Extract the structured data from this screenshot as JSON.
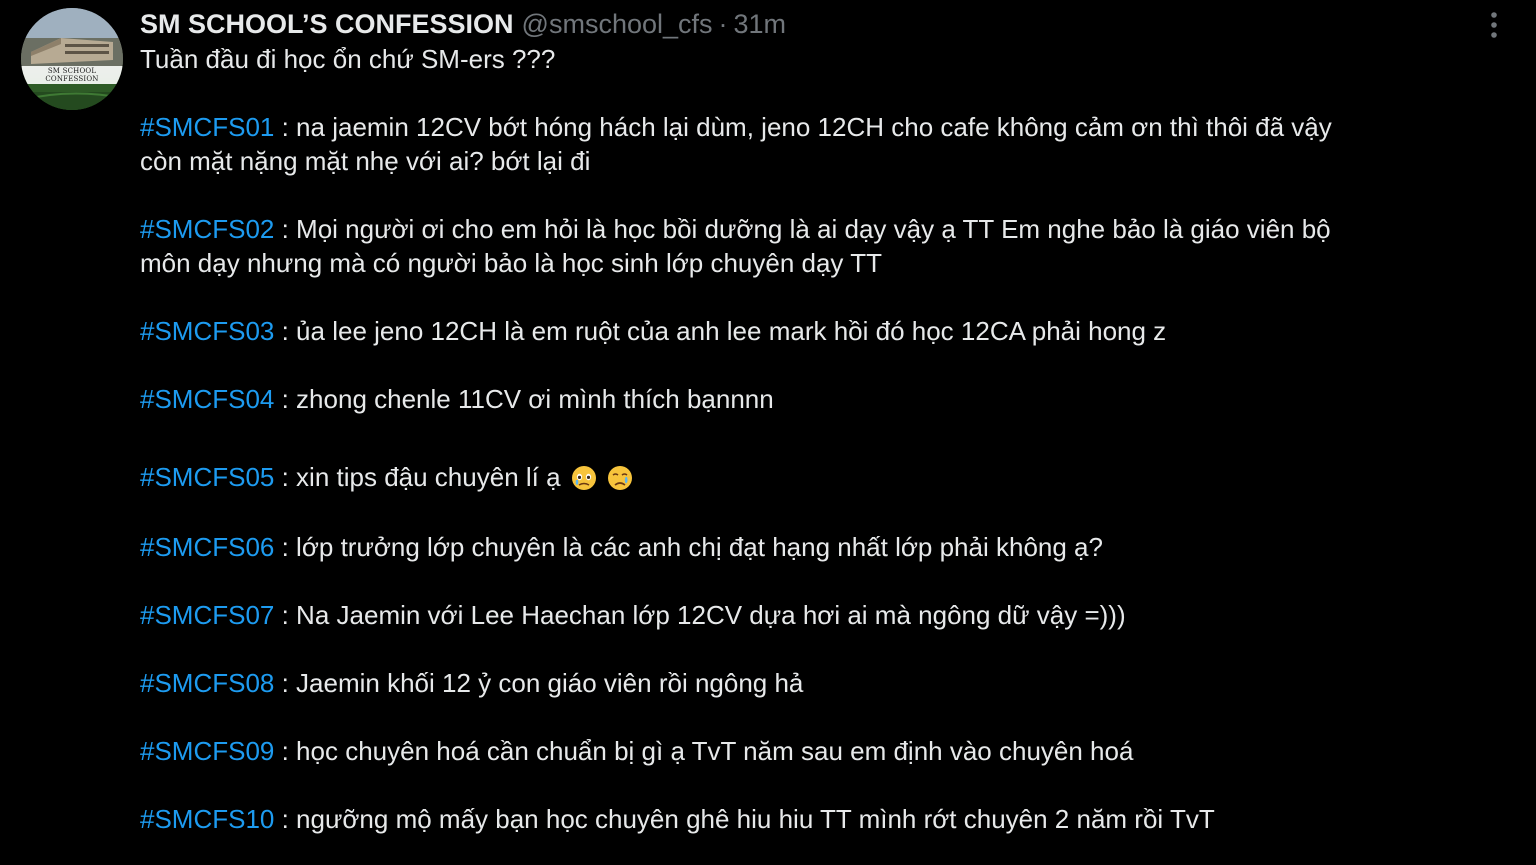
{
  "tweet": {
    "author": {
      "display_name": "SM SCHOOL’S CONFESSION",
      "handle": "@smschool_cfs",
      "separator": "·",
      "time": "31m",
      "avatar_label": "SM SCHOOL CONFESSION"
    },
    "intro": "Tuần đầu đi học ổn chứ SM-ers ???",
    "posts": [
      {
        "tag": "#SMCFS01",
        "lines": [
          " : na jaemin 12CV bớt hóng hách lại dùm, jeno 12CH cho cafe không cảm ơn thì thôi đã vậy",
          "còn mặt nặng mặt nhẹ với ai? bớt lại đi"
        ]
      },
      {
        "tag": "#SMCFS02",
        "lines": [
          " : Mọi người ơi cho em hỏi là học bồi dưỡng là ai dạy vậy ạ TT Em nghe bảo là giáo viên bộ",
          "môn dạy nhưng mà có người bảo là học sinh lớp chuyên dạy TT"
        ]
      },
      {
        "tag": "#SMCFS03",
        "lines": [
          " : ủa lee jeno 12CH là em ruột của anh lee mark hồi đó học 12CA phải hong z"
        ]
      },
      {
        "tag": "#SMCFS04",
        "lines": [
          " : zhong chenle 11CV ơi mình thích bạnnnn"
        ]
      },
      {
        "tag": "#SMCFS05",
        "lines": [
          " : xin tips đậu chuyên lí ạ"
        ]
      },
      {
        "tag": "#SMCFS06",
        "lines": [
          " : lớp trưởng lớp chuyên là các anh chị đạt hạng nhất lớp phải không ạ?"
        ]
      },
      {
        "tag": "#SMCFS07",
        "lines": [
          " : Na Jaemin với Lee Haechan lớp 12CV dựa hơi ai mà ngông dữ vậy =)))"
        ]
      },
      {
        "tag": "#SMCFS08",
        "lines": [
          " : Jaemin khối 12 ỷ con giáo viên rồi ngông hả"
        ]
      },
      {
        "tag": "#SMCFS09",
        "lines": [
          " : học chuyên hoá cần chuẩn bị gì ạ TvT năm sau em định vào chuyên hoá"
        ]
      },
      {
        "tag": "#SMCFS10",
        "lines": [
          " : ngưỡng mộ mấy bạn học chuyên ghê hiu hiu TT mình rớt chuyên 2 năm rồi TvT"
        ]
      }
    ],
    "emojis": [
      "face-holding-back-tears-icon",
      "crying-face-icon"
    ]
  },
  "colors": {
    "background": "#000000",
    "text": "#e7e9ea",
    "muted": "#71767b",
    "hashtag": "#1d9bf0"
  }
}
